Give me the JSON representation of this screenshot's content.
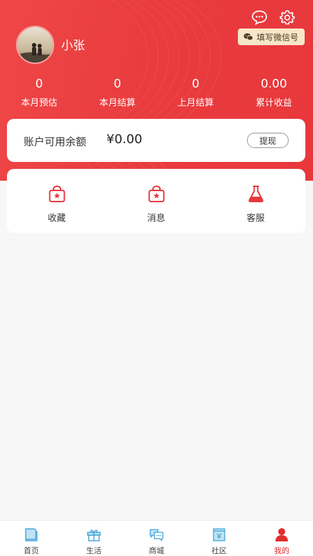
{
  "profile": {
    "username": "小张"
  },
  "header": {
    "wechat_pill": "填写微信号"
  },
  "stats": [
    {
      "value": "0",
      "label": "本月预估"
    },
    {
      "value": "0",
      "label": "本月结算"
    },
    {
      "value": "0",
      "label": "上月结算"
    },
    {
      "value": "0.00",
      "label": "累计收益"
    }
  ],
  "balance": {
    "label": "账户可用余额",
    "value": "¥0.00",
    "withdraw": "提现"
  },
  "menu": [
    {
      "label": "收藏",
      "icon": "bag-star-icon"
    },
    {
      "label": "消息",
      "icon": "bag-star-icon"
    },
    {
      "label": "客服",
      "icon": "flask-icon"
    }
  ],
  "tabs": [
    {
      "label": "首页",
      "icon": "book-icon"
    },
    {
      "label": "生活",
      "icon": "gift-icon"
    },
    {
      "label": "商城",
      "icon": "chat-bubbles-icon"
    },
    {
      "label": "社区",
      "icon": "community-icon"
    },
    {
      "label": "我的",
      "icon": "person-icon"
    }
  ],
  "colors": {
    "accent": "#e8383c",
    "pill_bg": "#f7e6c7",
    "icon_blue": "#3fa3d8",
    "active_tab": "#e02e2e"
  }
}
